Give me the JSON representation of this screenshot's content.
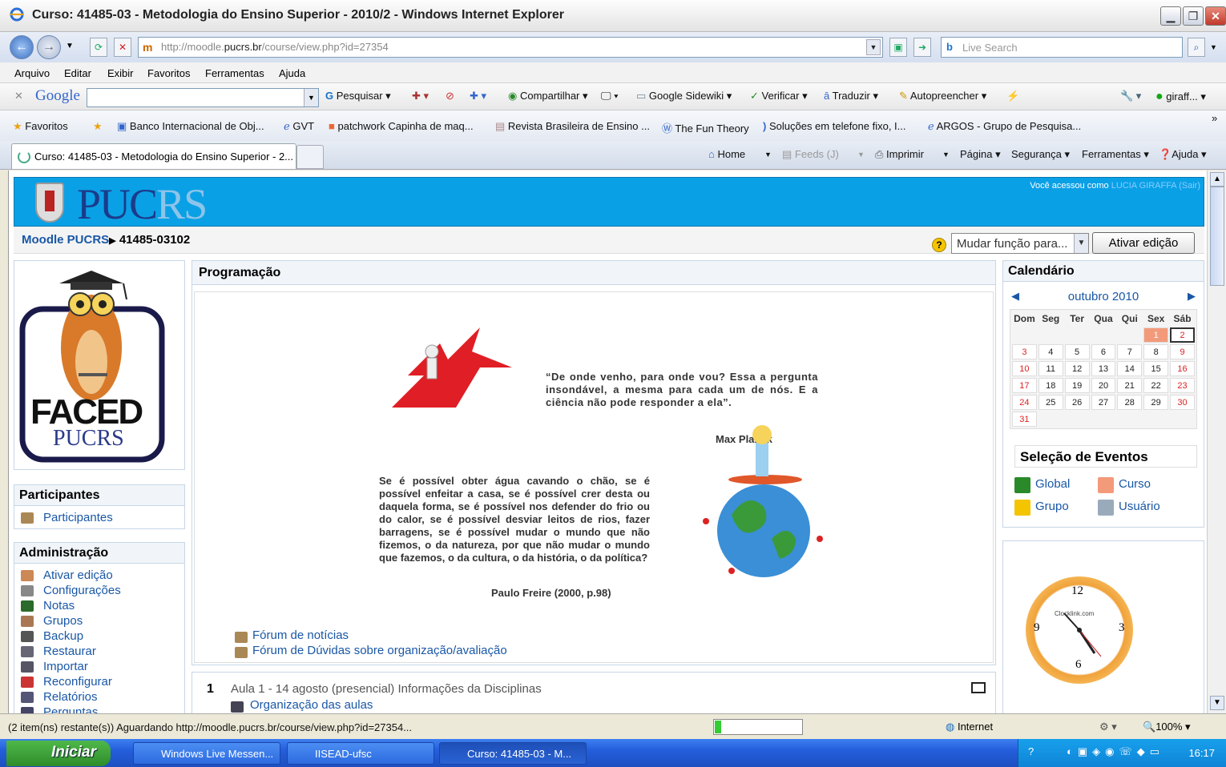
{
  "window": {
    "title": "Curso: 41485-03 - Metodologia do Ensino Superior - 2010/2 - Windows Internet Explorer"
  },
  "address": {
    "url_host_prefix": "http://moodle.",
    "url_host": "pucrs.br",
    "url_path": "/course/view.php?id=27354",
    "search_placeholder": "Live Search"
  },
  "menu": [
    "Arquivo",
    "Editar",
    "Exibir",
    "Favoritos",
    "Ferramentas",
    "Ajuda"
  ],
  "google_toolbar": {
    "logo": "Google",
    "pesquisar": "Pesquisar",
    "compartilhar": "Compartilhar",
    "sidewiki": "Google Sidewiki",
    "verificar": "Verificar",
    "traduzir": "Traduzir",
    "autopreencher": "Autopreencher",
    "user": "giraff..."
  },
  "favorites": {
    "label": "Favoritos",
    "items": [
      "Banco Internacional de Obj...",
      "GVT",
      "patchwork Capinha de maq...",
      "Revista Brasileira de Ensino ...",
      "The Fun Theory",
      "Soluções em telefone fixo, I...",
      "ARGOS - Grupo de Pesquisa..."
    ]
  },
  "tab": {
    "title": "Curso: 41485-03 - Metodologia do Ensino Superior - 2..."
  },
  "commands": {
    "home": "Home",
    "feeds": "Feeds (J)",
    "imprimir": "Imprimir",
    "pagina": "Página",
    "seguranca": "Segurança",
    "ferramentas": "Ferramentas",
    "ajuda": "Ajuda"
  },
  "page": {
    "logo_main": "PUC",
    "logo_light": "RS",
    "login_prefix": "Você acessou como ",
    "login_user": "LUCIA GIRAFFA",
    "login_logout": "(Sair)",
    "breadcrumb_home": "Moodle PUCRS",
    "breadcrumb_sep": "▶",
    "breadcrumb_course": "41485-03102",
    "role_select": "Mudar função para...",
    "edit_button": "Ativar edição",
    "faced_title": "FACED",
    "faced_sub": "PUCRS",
    "participants": {
      "title": "Participantes",
      "link": "Participantes"
    },
    "admin": {
      "title": "Administração",
      "links": [
        "Ativar edição",
        "Configurações",
        "Notas",
        "Grupos",
        "Backup",
        "Restaurar",
        "Importar",
        "Reconfigurar",
        "Relatórios",
        "Perguntas"
      ]
    },
    "programacao": {
      "title": "Programação",
      "quote1": "“De onde venho, para onde vou? Essa a pergunta insondável, a mesma para cada um de nós. E a ciência não pode responder a ela”.",
      "quote1_author": "Max Planck",
      "quote2": "Se é possível obter água cavando o chão, se é possível enfeitar a casa, se é possível crer desta ou daquela forma, se é possível nos defender do frio ou do calor, se é possível desviar leitos de rios, fazer barragens, se é possível mudar o mundo que não fizemos, o da natureza, por que não mudar o mundo que fazemos, o da cultura, o da história, o da política?",
      "quote2_author": "Paulo Freire (2000, p.98)",
      "forums": [
        "Fórum de notícias",
        "Fórum de Dúvidas sobre organização/avaliação"
      ]
    },
    "aula": {
      "number": "1",
      "title": "Aula 1 - 14 agosto (presencial) Informações da Disciplinas",
      "link": "Organização das aulas"
    },
    "calendar": {
      "title": "Calendário",
      "month": "outubro 2010",
      "weekdays": [
        "Dom",
        "Seg",
        "Ter",
        "Qua",
        "Qui",
        "Sex",
        "Sáb"
      ],
      "weeks": [
        [
          "",
          "",
          "",
          "",
          "",
          "1",
          "2"
        ],
        [
          "3",
          "4",
          "5",
          "6",
          "7",
          "8",
          "9"
        ],
        [
          "10",
          "11",
          "12",
          "13",
          "14",
          "15",
          "16"
        ],
        [
          "17",
          "18",
          "19",
          "20",
          "21",
          "22",
          "23"
        ],
        [
          "24",
          "25",
          "26",
          "27",
          "28",
          "29",
          "30"
        ],
        [
          "31",
          "",
          "",
          "",
          "",
          "",
          ""
        ]
      ],
      "today": "1",
      "selected": "2"
    },
    "events": {
      "title": "Seleção de Eventos",
      "global": "Global",
      "curso": "Curso",
      "grupo": "Grupo",
      "usuario": "Usuário"
    },
    "clock": {
      "brand": "Clocklink.com",
      "twelve": "12",
      "three": "3",
      "six": "6",
      "nine": "9"
    }
  },
  "status": {
    "text": "(2 item(ns) restante(s)) Aguardando http://moodle.pucrs.br/course/view.php?id=27354...",
    "zone": "Internet",
    "zoom": "100%",
    "progress_fraction": 0.07
  },
  "taskbar": {
    "start": "Iniciar",
    "tasks": [
      "Windows Live Messen...",
      "IISEAD-ufsc",
      "Curso: 41485-03 - M..."
    ],
    "time": "16:17"
  },
  "colors": {
    "header_blue": "#0aa0e6",
    "link_blue": "#1957a6",
    "today_cell": "#f39a7a"
  }
}
